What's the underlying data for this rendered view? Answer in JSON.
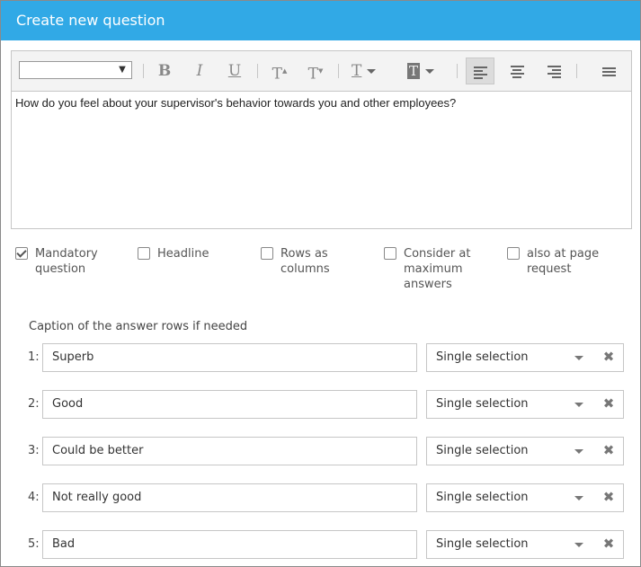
{
  "dialog": {
    "title": "Create new question"
  },
  "editor": {
    "font_value": "",
    "toolbar": {
      "bold": "B",
      "italic": "I",
      "underline": "U",
      "superscript": "T",
      "subscript": "T",
      "text_color": "T",
      "bg_color": "T"
    },
    "content": "How do you feel about your supervisor's behavior towards you and other employees?"
  },
  "options": [
    {
      "label": "Mandatory question",
      "checked": true
    },
    {
      "label": "Headline",
      "checked": false
    },
    {
      "label": "Rows as columns",
      "checked": false
    },
    {
      "label": "Consider at maximum answers",
      "checked": false
    },
    {
      "label": "also at page request",
      "checked": false
    }
  ],
  "answers": {
    "caption": "Caption of the answer rows if needed",
    "rows": [
      {
        "num": "1:",
        "value": "Superb",
        "type": "Single selection"
      },
      {
        "num": "2:",
        "value": "Good",
        "type": "Single selection"
      },
      {
        "num": "3:",
        "value": "Could be better",
        "type": "Single selection"
      },
      {
        "num": "4:",
        "value": "Not really good",
        "type": "Single selection"
      },
      {
        "num": "5:",
        "value": "Bad",
        "type": "Single selection"
      }
    ]
  },
  "colors": {
    "title_bar": "#31a9e6"
  },
  "icons": {
    "select_caret": "caret-down-icon",
    "delete": "close-x-icon",
    "align_left": "align-left-icon",
    "align_center": "align-center-icon",
    "align_right": "align-right-icon",
    "menu": "hamburger-icon"
  }
}
